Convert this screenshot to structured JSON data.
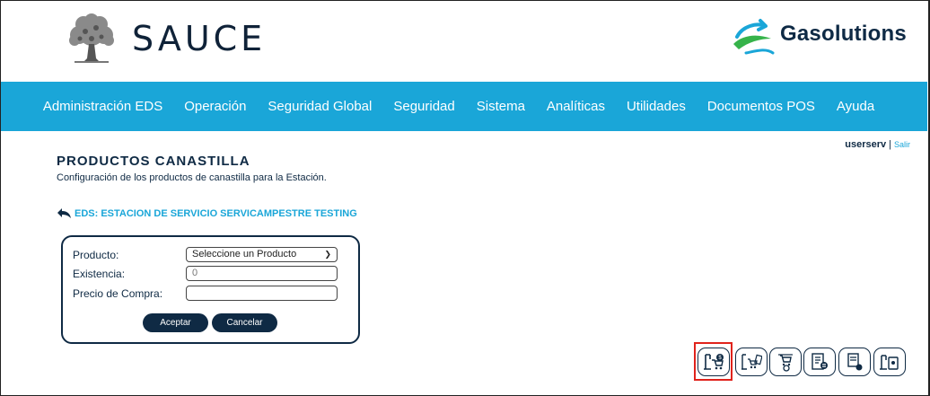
{
  "header": {
    "brand_left": "SAUCE",
    "brand_right": "Gasolutions"
  },
  "nav": {
    "items": [
      {
        "label": "Administración EDS"
      },
      {
        "label": "Operación"
      },
      {
        "label": "Seguridad Global"
      },
      {
        "label": "Seguridad"
      },
      {
        "label": "Sistema"
      },
      {
        "label": "Analíticas"
      },
      {
        "label": "Utilidades"
      },
      {
        "label": "Documentos POS"
      },
      {
        "label": "Ayuda"
      }
    ]
  },
  "user": {
    "name": "userserv",
    "separator": "|",
    "logout": "Salir"
  },
  "page": {
    "title": "PRODUCTOS CANASTILLA",
    "subtitle": "Configuración de los productos de canastilla para la Estación.",
    "eds_label": "EDS: ESTACION DE SERVICIO SERVICAMPESTRE TESTING"
  },
  "form": {
    "producto_label": "Producto:",
    "producto_selected": "Seleccione un Producto",
    "existencia_label": "Existencia:",
    "existencia_value": "0",
    "precio_label": "Precio de Compra:",
    "precio_value": "",
    "accept_label": "Aceptar",
    "cancel_label": "Cancelar"
  },
  "toolbar": {
    "buttons": [
      {
        "icon": "product-station-icon",
        "selected": true
      },
      {
        "icon": "cart-document-icon",
        "selected": false
      },
      {
        "icon": "cart-badge-icon",
        "selected": false
      },
      {
        "icon": "report-list-icon",
        "selected": false
      },
      {
        "icon": "document-user-icon",
        "selected": false
      },
      {
        "icon": "station-phone-icon",
        "selected": false
      }
    ],
    "highlight_color": "#e0231c"
  },
  "colors": {
    "accent": "#1aa6d8",
    "dark": "#0f2a44"
  }
}
